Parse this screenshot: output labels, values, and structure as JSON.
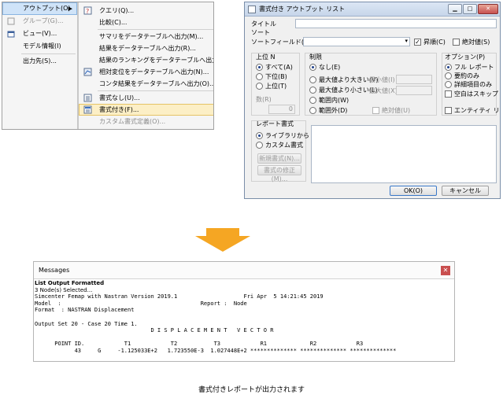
{
  "menu": {
    "main_items": [
      {
        "label": "アウトプット(O)",
        "state": "highlighted"
      },
      {
        "label": "グループ(G)...",
        "state": "disabled"
      },
      {
        "label": "ビュー(V)..."
      },
      {
        "label": "モデル情報(I)"
      },
      {
        "label": "出力先(S)..."
      }
    ],
    "sub_items": [
      {
        "label": "クエリ(Q)..."
      },
      {
        "label": "比較(C)..."
      },
      {
        "label": "サマリをデータテーブルへ出力(M)..."
      },
      {
        "label": "結果をデータテーブルへ出力(R)..."
      },
      {
        "label": "結果のランキングをデータテーブルへ出力(K)..."
      },
      {
        "label": "相対変位をデータテーブルへ出力(N)..."
      },
      {
        "label": "コンタ結果をデータテーブルへ出力(O)..."
      },
      {
        "label": "書式なし(U)..."
      },
      {
        "label": "書式付き(F)...",
        "state": "highlighted"
      },
      {
        "label": "カスタム書式定義(O)...",
        "state": "disabled"
      }
    ]
  },
  "dialog": {
    "title": "書式付き アウトプット リスト",
    "title_label": "タイトル",
    "title_value": "",
    "sort_label": "ソート",
    "sort_field_label": "ソートフィールド(F)",
    "ascending_label": "昇順(C)",
    "absolute_label": "絶対値(S)",
    "top_n": {
      "label": "上位 N",
      "options": [
        "すべて(A)",
        "下位(B)",
        "上位(T)"
      ],
      "count_label": "数(R)",
      "count_value": "0"
    },
    "limit": {
      "label": "制限",
      "options": [
        "なし(E)",
        "最大値より大きい(V)",
        "最大値より小さい(L)",
        "範囲内(W)",
        "範囲外(D)"
      ],
      "min_label": "最小値(I)",
      "max_label": "最大値(X)",
      "abs_label": "絶対値(U)"
    },
    "options": {
      "label": "オプション(P)",
      "items": [
        "フル レポート",
        "要約のみ",
        "詳細項目のみ",
        "空白はスキップ"
      ],
      "entity_list_label": "エンティティ リスト"
    },
    "report_format": {
      "label": "レポート書式",
      "options": [
        "ライブラリから",
        "カスタム書式"
      ],
      "new_button": "新規書式(N)...",
      "edit_button": "書式の修正(M)..."
    },
    "ok_button": "OK(O)",
    "cancel_button": "キャンセル"
  },
  "messages": {
    "title": "Messages",
    "lines": [
      "List Output Formatted",
      "3 Node(s) Selected...",
      "Simcenter Femap with Nastran Version 2019.1                    Fri Apr  5 14:21:45 2019",
      "Model  :                                          Report :  Node",
      "Format  : NASTRAN Displacement",
      "",
      "Output Set 20 - Case 20 Time 1.",
      "                                   D I S P L A C E M E N T   V E C T O R",
      "",
      "      POINT ID.            T1            T2           T3            R1             R2            R3",
      "            43     G     -1.125033E+2   1.723550E-3  1.027448E+2 ************** ************** **************"
    ]
  },
  "caption": "書式付きレポートが出力されます"
}
